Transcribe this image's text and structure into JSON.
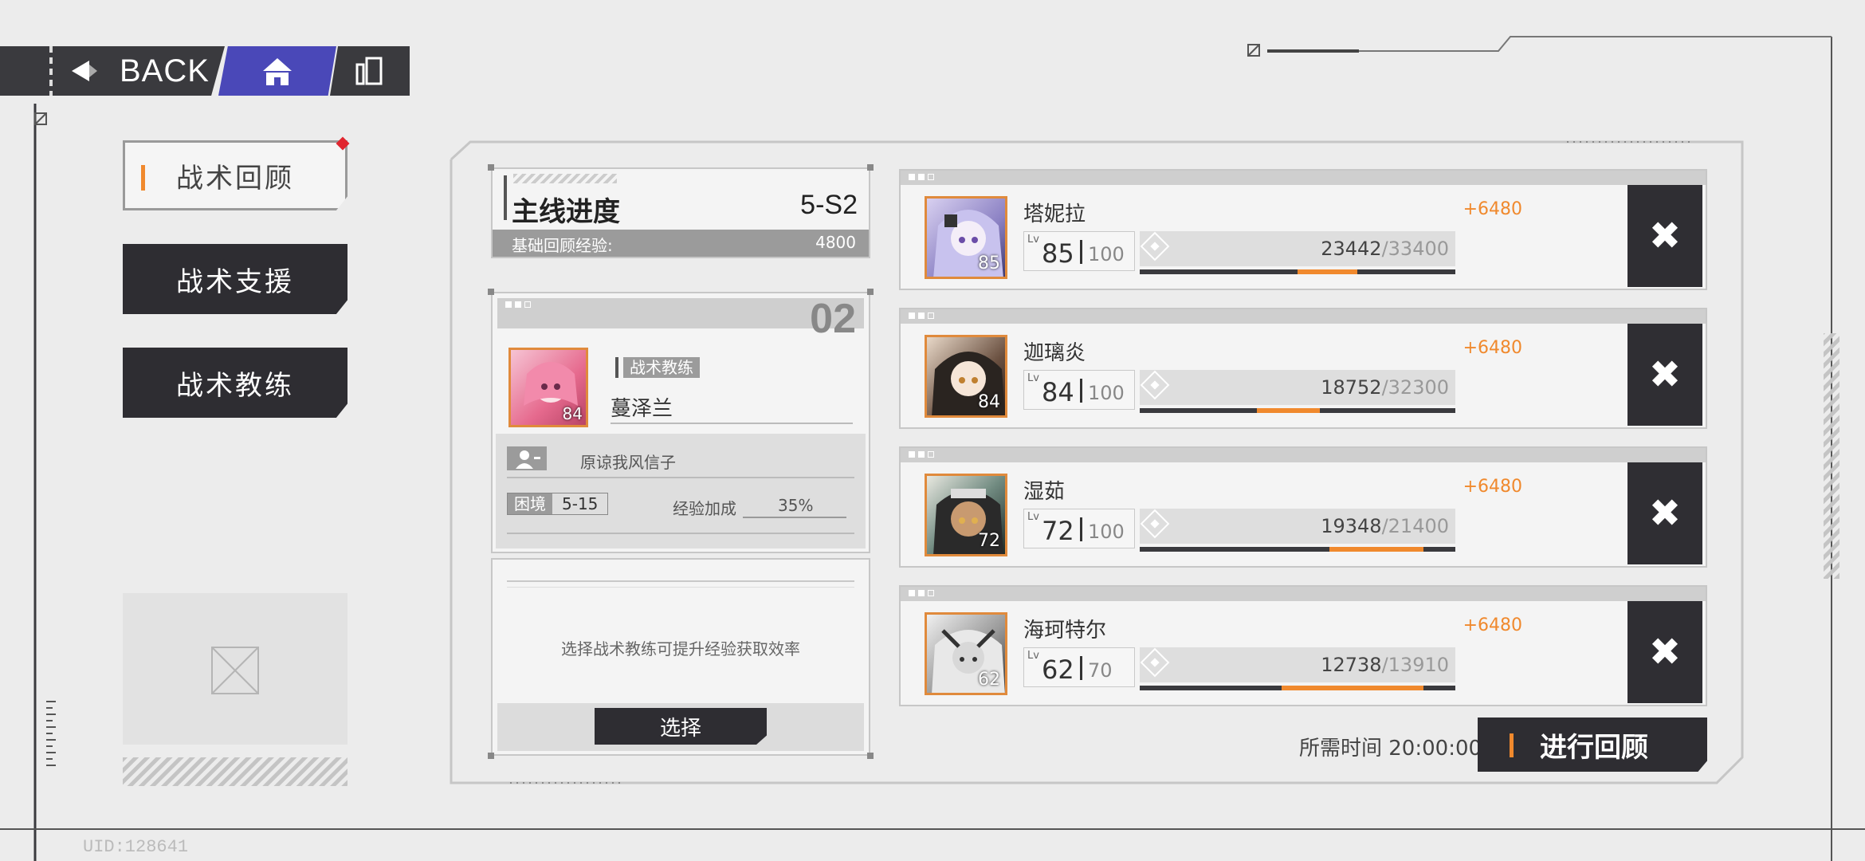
{
  "nav": {
    "back_label": "BACK",
    "home_icon": "home-icon",
    "menu_icon": "menu-icon",
    "home_color": "#4a48b8"
  },
  "tabs": [
    {
      "label": "战术回顾",
      "active": true,
      "badge": true
    },
    {
      "label": "战术支援",
      "active": false
    },
    {
      "label": "战术教练",
      "active": false
    }
  ],
  "progress": {
    "title": "主线进度",
    "stage": "5-S2",
    "exp_label": "基础回顾经验:",
    "exp_value": "4800"
  },
  "coach": {
    "slot_number": "02",
    "tag": "战术教练",
    "name": "蔓泽兰",
    "level": "84",
    "player_name": "原谅我风信子",
    "difficulty_label": "困境",
    "difficulty_value": "5-15",
    "bonus_label": "经验加成",
    "bonus_value": "35%"
  },
  "select_panel": {
    "hint": "选择战术教练可提升经验获取效率",
    "button": "选择"
  },
  "characters": [
    {
      "name": "塔妮拉",
      "level": "85",
      "max_level": "100",
      "gain": "+6480",
      "exp": "23442",
      "exp_max": "/33400",
      "current_fraction": 0.5,
      "gain_fraction": 0.19,
      "portrait_level": "85"
    },
    {
      "name": "迦璃炎",
      "level": "84",
      "max_level": "100",
      "gain": "+6480",
      "exp": "18752",
      "exp_max": "/32300",
      "current_fraction": 0.37,
      "gain_fraction": 0.2,
      "portrait_level": "84"
    },
    {
      "name": "湿茹",
      "level": "72",
      "max_level": "100",
      "gain": "+6480",
      "exp": "19348",
      "exp_max": "/21400",
      "current_fraction": 0.6,
      "gain_fraction": 0.3,
      "portrait_level": "72"
    },
    {
      "name": "海珂特尔",
      "level": "62",
      "max_level": "70",
      "gain": "+6480",
      "exp": "12738",
      "exp_max": "/13910",
      "current_fraction": 0.45,
      "gain_fraction": 0.45,
      "portrait_level": "62"
    }
  ],
  "footer": {
    "time_label": "所需时间 20:00:00",
    "start_button": "进行回顾",
    "uid": "UID:128641"
  },
  "colors": {
    "accent": "#f0892d",
    "dark": "#2f2e33",
    "badge": "#e0262f"
  }
}
